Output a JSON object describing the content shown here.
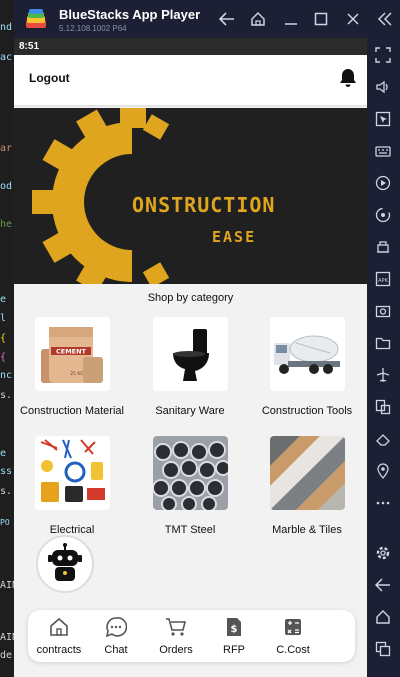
{
  "window": {
    "app_title": "BlueStacks App Player",
    "version": "5.12.108.1002  P64"
  },
  "editor_fragments": [
    "nd",
    "ac",
    "ar",
    "od",
    "he",
    "e",
    "l",
    "{",
    "{",
    "nc",
    "s.",
    "e",
    "ss",
    "s.",
    "PO",
    "AIN",
    "AIN",
    "de"
  ],
  "statusbar": {
    "time": "8:51"
  },
  "appbar": {
    "logout_label": "Logout"
  },
  "banner": {
    "title": "ONSTRUCTION",
    "subtitle": "EASE"
  },
  "shop": {
    "heading": "Shop by category",
    "categories": [
      {
        "label": "Construction Material",
        "icon": "cement-bags-icon"
      },
      {
        "label": "Sanitary Ware",
        "icon": "toilet-icon"
      },
      {
        "label": "Construction Tools",
        "icon": "concrete-mixer-truck-icon"
      },
      {
        "label": "Electrical",
        "icon": "electrical-tools-icon"
      },
      {
        "label": "TMT Steel",
        "icon": "steel-pipes-icon"
      },
      {
        "label": "Marble & Tiles",
        "icon": "marble-tiles-icon"
      }
    ],
    "cement_bag_text": "CEMENT",
    "cement_bag_weight": "25 KG"
  },
  "bottom_nav": [
    {
      "label": "contracts",
      "icon": "home-icon"
    },
    {
      "label": "Chat",
      "icon": "chat-bubble-icon"
    },
    {
      "label": "Orders",
      "icon": "cart-icon"
    },
    {
      "label": "RFP",
      "icon": "dollar-document-icon"
    },
    {
      "label": "C.Cost",
      "icon": "calculator-icon"
    }
  ],
  "colors": {
    "brand_yellow": "#e0a51f",
    "bluestacks_bar": "#1d2035",
    "banner_bg": "#202020"
  }
}
